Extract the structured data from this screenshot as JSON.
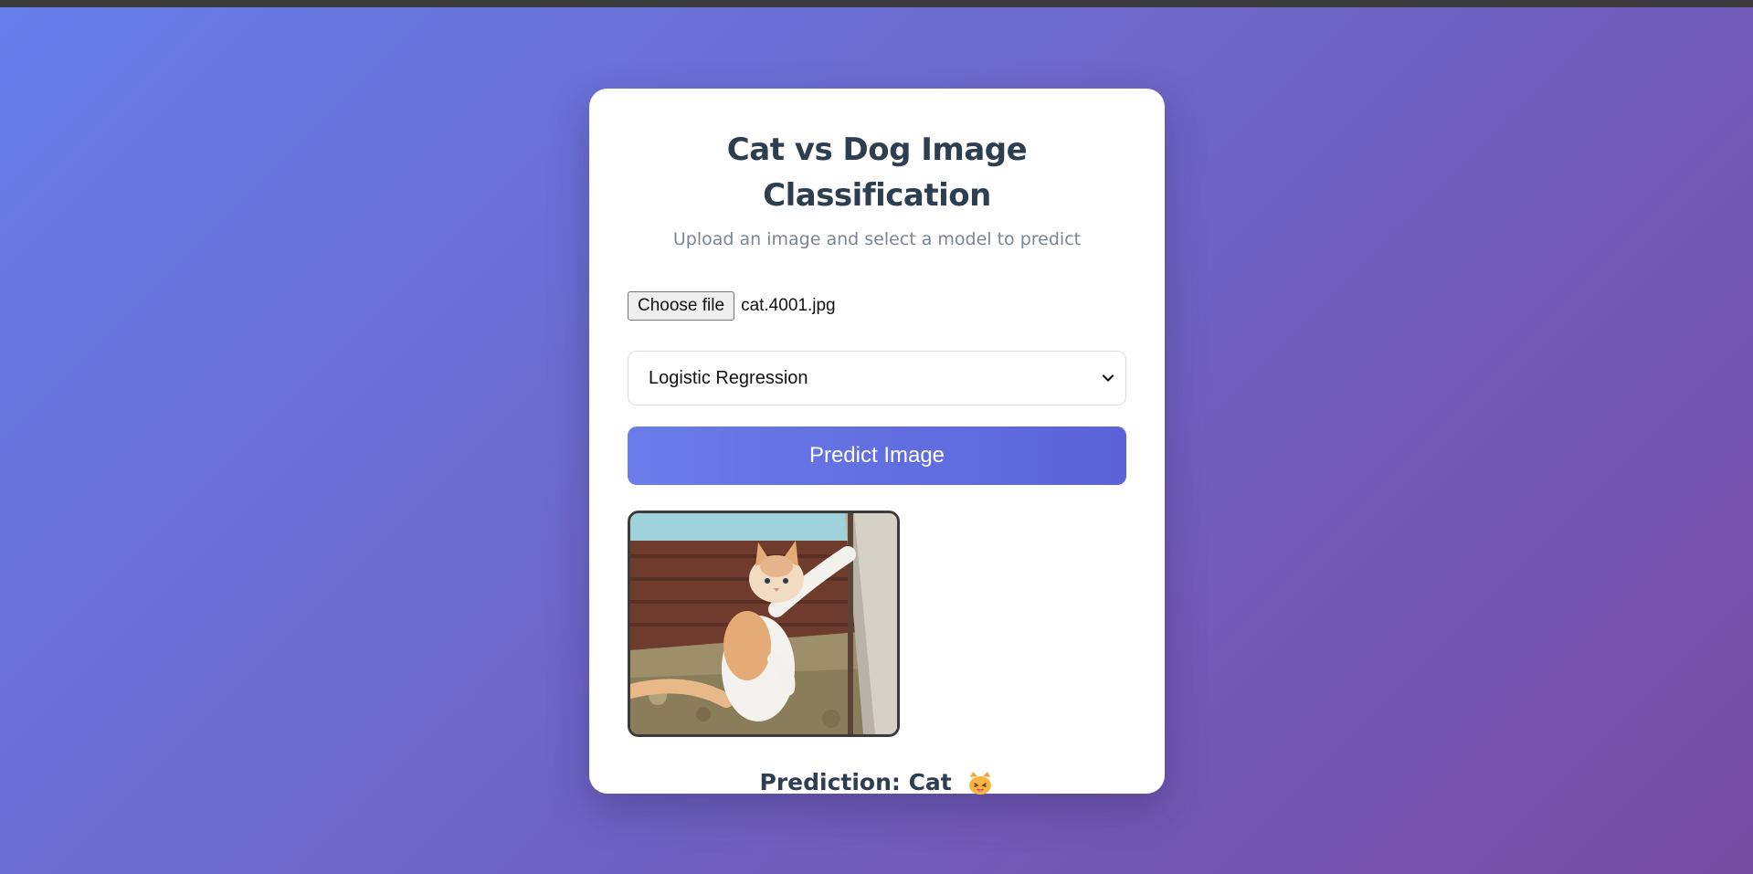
{
  "app": {
    "title": "Cat vs Dog Image Classification",
    "subtitle": "Upload an image and select a model to predict"
  },
  "upload": {
    "button_label": "Choose file",
    "file_name": "cat.4001.jpg"
  },
  "model_select": {
    "selected": "Logistic Regression"
  },
  "predict_button": {
    "label": "Predict Image"
  },
  "preview": {
    "icon": "cat-photo",
    "alt": "Uploaded image preview"
  },
  "result": {
    "prediction": "Prediction: Cat",
    "emoji_icon": "cat-face-emoji"
  },
  "colors": {
    "background_start": "#667eea",
    "background_end": "#764ba2",
    "button_start": "#6a7ceb",
    "button_end": "#5a63d8",
    "title": "#2c3e50",
    "subtitle": "#7a8591"
  }
}
